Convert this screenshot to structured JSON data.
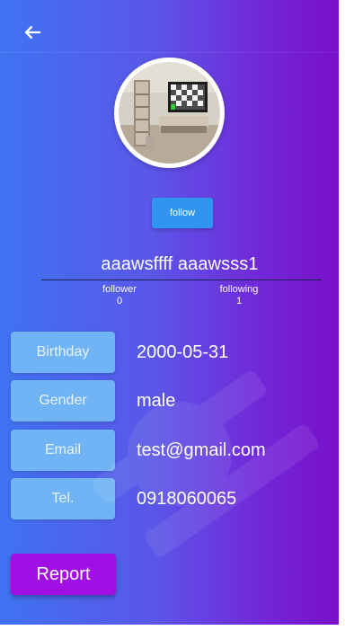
{
  "header": {
    "back_icon": "arrow-left-icon"
  },
  "profile": {
    "follow_label": "follow",
    "display_name": "aaawsffff  aaawsss1",
    "stats": [
      {
        "label": "follower",
        "value": "0"
      },
      {
        "label": "following",
        "value": "1"
      }
    ]
  },
  "details": [
    {
      "label": "Birthday",
      "value": "2000-05-31"
    },
    {
      "label": "Gender",
      "value": "male"
    },
    {
      "label": "Email",
      "value": "test@gmail.com"
    },
    {
      "label": "Tel.",
      "value": "0918060065"
    }
  ],
  "actions": {
    "report_label": "Report"
  },
  "colors": {
    "gradient_left": "#3f73f1",
    "gradient_right": "#7810c9",
    "follow_button": "#2f95f0",
    "field_label_background": "#70b4f5",
    "report_button": "#a20fe5"
  }
}
